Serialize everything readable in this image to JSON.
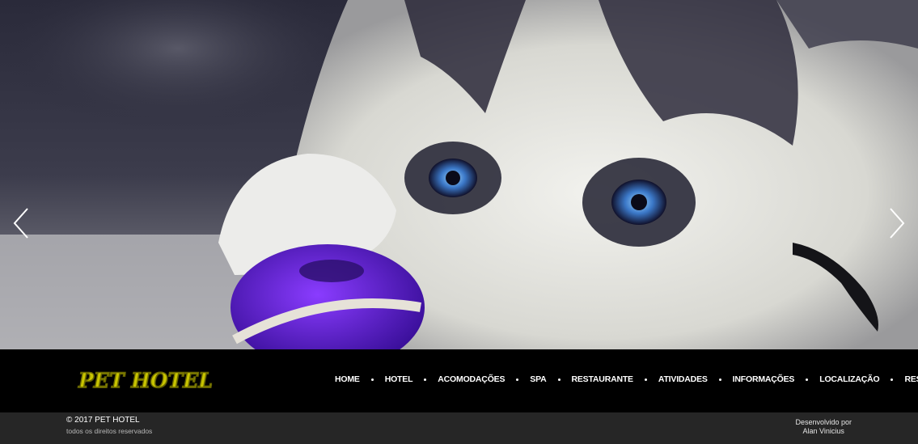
{
  "hero": {
    "image_subject": "husky puppy with purple ball",
    "prev_icon": "chevron-left-icon",
    "next_icon": "chevron-right-icon"
  },
  "brand": {
    "logo_text": "PET HOTEL",
    "logo_color": "#c8c400"
  },
  "nav": {
    "items": [
      {
        "label": "HOME"
      },
      {
        "label": "HOTEL"
      },
      {
        "label": "ACOMODAÇÕES"
      },
      {
        "label": "SPA"
      },
      {
        "label": "RESTAURANTE"
      },
      {
        "label": "ATIVIDADES"
      },
      {
        "label": "INFORMAÇÕES"
      },
      {
        "label": "LOCALIZAÇÃO"
      },
      {
        "label": "RESERVAS"
      }
    ]
  },
  "footer": {
    "copyright": "© 2017 PET HOTEL",
    "rights": "todos os direitos reservados",
    "dev_label": "Desenvolvido por",
    "dev_name": "Alan Vinicius"
  }
}
